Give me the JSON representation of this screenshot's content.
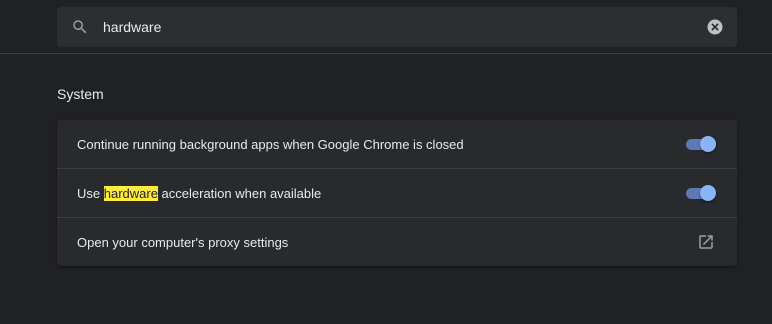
{
  "search": {
    "value": "hardware",
    "icon": "search-icon",
    "clear_icon": "clear-icon"
  },
  "section": {
    "title": "System"
  },
  "settings": [
    {
      "label": "Continue running background apps when Google Chrome is closed",
      "control": "toggle",
      "checked": true
    },
    {
      "label_before": "Use ",
      "label_highlight": "hardware",
      "label_after": " acceleration when available",
      "control": "toggle",
      "checked": true
    },
    {
      "label": "Open your computer's proxy settings",
      "control": "launch",
      "icon": "open-in-new-icon"
    }
  ],
  "colors": {
    "background": "#202124",
    "card": "#292a2d",
    "accent": "#8ab4f8",
    "highlight": "#ffeb3b"
  }
}
